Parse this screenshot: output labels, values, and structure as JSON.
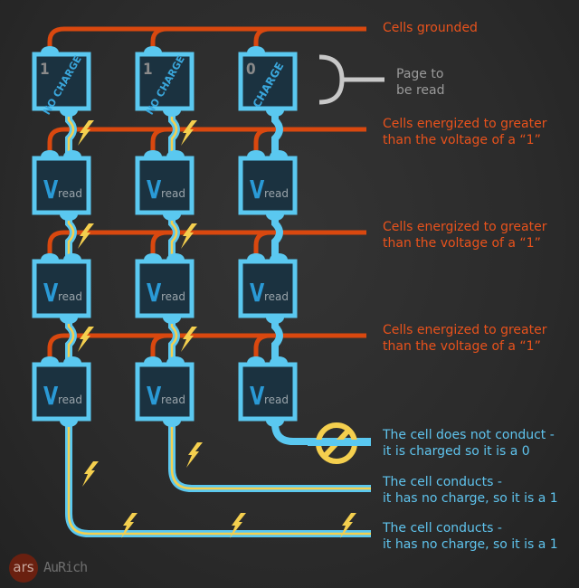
{
  "colors": {
    "wordline": "#d9480f",
    "bitline": "#5ac8f0",
    "conduct": "#f4cf4e",
    "cell_fill": "#1b3240",
    "background": "#2b2b2b"
  },
  "cells": {
    "top_row": [
      {
        "bit": "1",
        "state": "NO CHARGE"
      },
      {
        "bit": "1",
        "state": "NO CHARGE"
      },
      {
        "bit": "0",
        "state": "CHARGE"
      }
    ],
    "read_label_v": "V",
    "read_label_sub": "read"
  },
  "labels": {
    "grounded": "Cells grounded",
    "page": [
      "Page to",
      "be read"
    ],
    "energized": [
      [
        "Cells energized to greater",
        "than the voltage of a “1”"
      ],
      [
        "Cells energized to greater",
        "than the voltage of a “1”"
      ],
      [
        "Cells energized to greater",
        "than the voltage of a “1”"
      ]
    ],
    "no_conduct": [
      "The cell does not conduct -",
      "it is charged so it is a 0"
    ],
    "conduct_2": [
      "The cell conducts -",
      "it has no charge, so it is a 1"
    ],
    "conduct_1": [
      "The cell conducts -",
      "it has no charge, so it is a 1"
    ]
  },
  "icons": {
    "no_current": "prohibited-icon",
    "current": "lightning-bolt-icon",
    "page_bracket": "bracket-icon"
  },
  "credit": {
    "logo": "ars",
    "artist": "AuRich"
  }
}
